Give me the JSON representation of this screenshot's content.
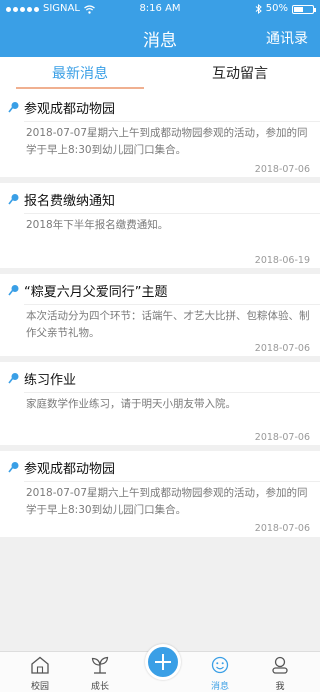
{
  "status_bar": {
    "carrier": "SIGNAL",
    "time": "8:16 AM",
    "battery": "50%",
    "battery_level": 0.5
  },
  "header": {
    "title": "消息",
    "right_action": "通讯录"
  },
  "tabs": [
    {
      "label": "最新消息",
      "active": true
    },
    {
      "label": "互动留言",
      "active": false
    }
  ],
  "messages": [
    {
      "title": "参观成都动物园",
      "body": "2018-07-07星期六上午到成都动物园参观的活动，参加的同学于早上8:30到幼儿园门口集合。",
      "date": "2018-07-06"
    },
    {
      "title": "报名费缴纳通知",
      "body": "2018年下半年报名缴费通知。",
      "date": "2018-06-19"
    },
    {
      "title": "“粽夏六月父爱同行”主题",
      "body": "本次活动分为四个环节：话端午、才艺大比拼、包粽体验、制作父亲节礼物。",
      "date": "2018-07-06"
    },
    {
      "title": "练习作业",
      "body": "家庭数学作业练习，请于明天小朋友带入院。",
      "date": "2018-07-06"
    },
    {
      "title": "参观成都动物园",
      "body": "2018-07-07星期六上午到成都动物园参观的活动，参加的同学于早上8:30到幼儿园门口集合。",
      "date": "2018-07-06"
    }
  ],
  "tabbar": {
    "items": [
      {
        "label": "校园",
        "icon": "house-icon"
      },
      {
        "label": "成长",
        "icon": "sprout-icon"
      },
      {
        "label": "",
        "icon": "plus-icon"
      },
      {
        "label": "消息",
        "icon": "smile-icon"
      },
      {
        "label": "我",
        "icon": "profile-icon"
      }
    ]
  },
  "colors": {
    "accent": "#3a9fe6",
    "background": "#f0f0f0"
  }
}
